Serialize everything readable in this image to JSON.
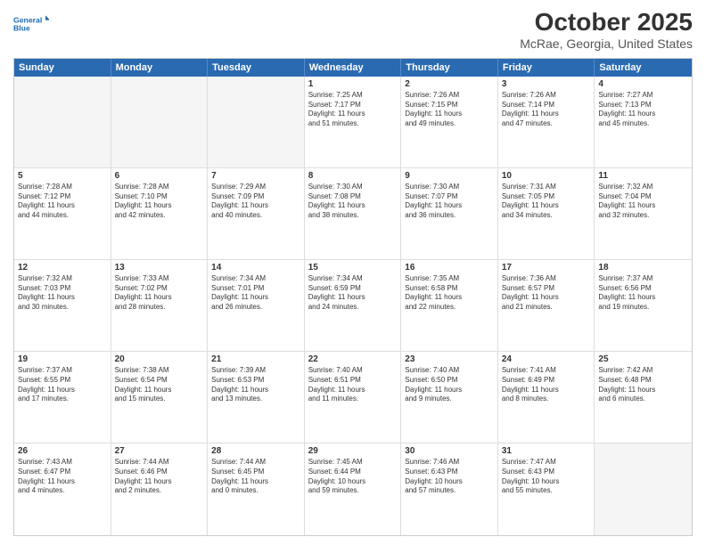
{
  "logo": {
    "line1": "General",
    "line2": "Blue"
  },
  "title": "October 2025",
  "subtitle": "McRae, Georgia, United States",
  "header_days": [
    "Sunday",
    "Monday",
    "Tuesday",
    "Wednesday",
    "Thursday",
    "Friday",
    "Saturday"
  ],
  "weeks": [
    [
      {
        "day": "",
        "info": ""
      },
      {
        "day": "",
        "info": ""
      },
      {
        "day": "",
        "info": ""
      },
      {
        "day": "1",
        "info": "Sunrise: 7:25 AM\nSunset: 7:17 PM\nDaylight: 11 hours\nand 51 minutes."
      },
      {
        "day": "2",
        "info": "Sunrise: 7:26 AM\nSunset: 7:15 PM\nDaylight: 11 hours\nand 49 minutes."
      },
      {
        "day": "3",
        "info": "Sunrise: 7:26 AM\nSunset: 7:14 PM\nDaylight: 11 hours\nand 47 minutes."
      },
      {
        "day": "4",
        "info": "Sunrise: 7:27 AM\nSunset: 7:13 PM\nDaylight: 11 hours\nand 45 minutes."
      }
    ],
    [
      {
        "day": "5",
        "info": "Sunrise: 7:28 AM\nSunset: 7:12 PM\nDaylight: 11 hours\nand 44 minutes."
      },
      {
        "day": "6",
        "info": "Sunrise: 7:28 AM\nSunset: 7:10 PM\nDaylight: 11 hours\nand 42 minutes."
      },
      {
        "day": "7",
        "info": "Sunrise: 7:29 AM\nSunset: 7:09 PM\nDaylight: 11 hours\nand 40 minutes."
      },
      {
        "day": "8",
        "info": "Sunrise: 7:30 AM\nSunset: 7:08 PM\nDaylight: 11 hours\nand 38 minutes."
      },
      {
        "day": "9",
        "info": "Sunrise: 7:30 AM\nSunset: 7:07 PM\nDaylight: 11 hours\nand 36 minutes."
      },
      {
        "day": "10",
        "info": "Sunrise: 7:31 AM\nSunset: 7:05 PM\nDaylight: 11 hours\nand 34 minutes."
      },
      {
        "day": "11",
        "info": "Sunrise: 7:32 AM\nSunset: 7:04 PM\nDaylight: 11 hours\nand 32 minutes."
      }
    ],
    [
      {
        "day": "12",
        "info": "Sunrise: 7:32 AM\nSunset: 7:03 PM\nDaylight: 11 hours\nand 30 minutes."
      },
      {
        "day": "13",
        "info": "Sunrise: 7:33 AM\nSunset: 7:02 PM\nDaylight: 11 hours\nand 28 minutes."
      },
      {
        "day": "14",
        "info": "Sunrise: 7:34 AM\nSunset: 7:01 PM\nDaylight: 11 hours\nand 26 minutes."
      },
      {
        "day": "15",
        "info": "Sunrise: 7:34 AM\nSunset: 6:59 PM\nDaylight: 11 hours\nand 24 minutes."
      },
      {
        "day": "16",
        "info": "Sunrise: 7:35 AM\nSunset: 6:58 PM\nDaylight: 11 hours\nand 22 minutes."
      },
      {
        "day": "17",
        "info": "Sunrise: 7:36 AM\nSunset: 6:57 PM\nDaylight: 11 hours\nand 21 minutes."
      },
      {
        "day": "18",
        "info": "Sunrise: 7:37 AM\nSunset: 6:56 PM\nDaylight: 11 hours\nand 19 minutes."
      }
    ],
    [
      {
        "day": "19",
        "info": "Sunrise: 7:37 AM\nSunset: 6:55 PM\nDaylight: 11 hours\nand 17 minutes."
      },
      {
        "day": "20",
        "info": "Sunrise: 7:38 AM\nSunset: 6:54 PM\nDaylight: 11 hours\nand 15 minutes."
      },
      {
        "day": "21",
        "info": "Sunrise: 7:39 AM\nSunset: 6:53 PM\nDaylight: 11 hours\nand 13 minutes."
      },
      {
        "day": "22",
        "info": "Sunrise: 7:40 AM\nSunset: 6:51 PM\nDaylight: 11 hours\nand 11 minutes."
      },
      {
        "day": "23",
        "info": "Sunrise: 7:40 AM\nSunset: 6:50 PM\nDaylight: 11 hours\nand 9 minutes."
      },
      {
        "day": "24",
        "info": "Sunrise: 7:41 AM\nSunset: 6:49 PM\nDaylight: 11 hours\nand 8 minutes."
      },
      {
        "day": "25",
        "info": "Sunrise: 7:42 AM\nSunset: 6:48 PM\nDaylight: 11 hours\nand 6 minutes."
      }
    ],
    [
      {
        "day": "26",
        "info": "Sunrise: 7:43 AM\nSunset: 6:47 PM\nDaylight: 11 hours\nand 4 minutes."
      },
      {
        "day": "27",
        "info": "Sunrise: 7:44 AM\nSunset: 6:46 PM\nDaylight: 11 hours\nand 2 minutes."
      },
      {
        "day": "28",
        "info": "Sunrise: 7:44 AM\nSunset: 6:45 PM\nDaylight: 11 hours\nand 0 minutes."
      },
      {
        "day": "29",
        "info": "Sunrise: 7:45 AM\nSunset: 6:44 PM\nDaylight: 10 hours\nand 59 minutes."
      },
      {
        "day": "30",
        "info": "Sunrise: 7:46 AM\nSunset: 6:43 PM\nDaylight: 10 hours\nand 57 minutes."
      },
      {
        "day": "31",
        "info": "Sunrise: 7:47 AM\nSunset: 6:43 PM\nDaylight: 10 hours\nand 55 minutes."
      },
      {
        "day": "",
        "info": ""
      }
    ]
  ]
}
